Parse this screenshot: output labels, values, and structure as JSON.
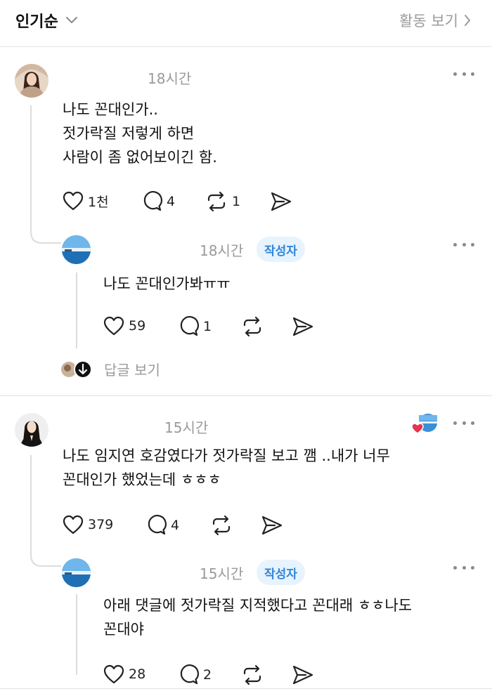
{
  "header": {
    "sort_label": "인기순",
    "activity_label": "활동 보기"
  },
  "comments": [
    {
      "time": "18시간",
      "text": "나도 꼰대인가..\n젓가락질 저렇게 하면\n사람이 좀 없어보이긴 함.",
      "likes": "1천",
      "replies": "4",
      "reposts": "1",
      "reply": {
        "time": "18시간",
        "badge": "작성자",
        "text": "나도 꼰대인가봐ㅠㅠ",
        "likes": "59",
        "replies": "1"
      },
      "view_replies_label": "답글 보기"
    },
    {
      "time": "15시간",
      "text": "나도 임지연 호감였다가 젓가락질 보고 깸 ..내가 너무\n꼰대인가 했었는데 ㅎㅎㅎ",
      "likes": "379",
      "replies": "4",
      "reply": {
        "time": "15시간",
        "badge": "작성자",
        "text": "아래 댓글에 젓가락질 지적했다고 꼰대래 ㅎㅎ나도\n꼰대야",
        "likes": "28",
        "replies": "2"
      }
    }
  ],
  "colors": {
    "badge_bg": "#e7f3fd",
    "badge_text": "#2f86d8",
    "muted": "#9a9a9a",
    "heart_red": "#e8344e"
  }
}
